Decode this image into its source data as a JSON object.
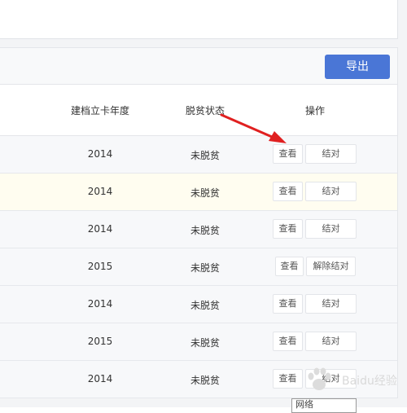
{
  "toolbar": {
    "export_label": "导出"
  },
  "table": {
    "headers": {
      "year": "建档立卡年度",
      "status": "脱贫状态",
      "ops": "操作"
    },
    "rows": [
      {
        "year": "2014",
        "status": "未脱贫",
        "view": "查看",
        "action": "结对"
      },
      {
        "year": "2014",
        "status": "未脱贫",
        "view": "查看",
        "action": "结对"
      },
      {
        "year": "2014",
        "status": "未脱贫",
        "view": "查看",
        "action": "结对"
      },
      {
        "year": "2015",
        "status": "未脱贫",
        "view": "查看",
        "action": "解除结对"
      },
      {
        "year": "2014",
        "status": "未脱贫",
        "view": "查看",
        "action": "结对"
      },
      {
        "year": "2015",
        "status": "未脱贫",
        "view": "查看",
        "action": "结对"
      },
      {
        "year": "2014",
        "status": "未脱贫",
        "view": "查看",
        "action": "结对"
      }
    ]
  },
  "bottom_field": {
    "value": "网络"
  },
  "watermark": {
    "text": "Baidu经验",
    "icon": "paw-icon"
  },
  "colors": {
    "accent": "#4a76d6",
    "arrow": "#e02020",
    "row_highlight": "#fffdf0"
  }
}
